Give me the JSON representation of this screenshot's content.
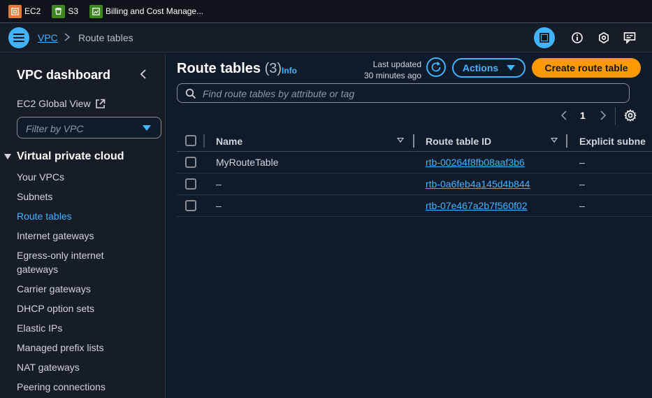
{
  "favorites": [
    {
      "label": "EC2",
      "icon": "ec2-icon",
      "color": "#e07b39"
    },
    {
      "label": "S3",
      "icon": "s3-icon",
      "color": "#3f8624"
    },
    {
      "label": "Billing and Cost Manage...",
      "icon": "billing-icon",
      "color": "#3f8624"
    }
  ],
  "topnav": {
    "service": "VPC",
    "current": "Route tables"
  },
  "sidebar": {
    "title": "VPC dashboard",
    "ec2_global_view": "EC2 Global View",
    "filter_placeholder": "Filter by VPC",
    "section": "Virtual private cloud",
    "items": [
      {
        "label": "Your VPCs"
      },
      {
        "label": "Subnets"
      },
      {
        "label": "Route tables"
      },
      {
        "label": "Internet gateways"
      },
      {
        "label": "Egress-only internet gateways"
      },
      {
        "label": "Carrier gateways"
      },
      {
        "label": "DHCP option sets"
      },
      {
        "label": "Elastic IPs"
      },
      {
        "label": "Managed prefix lists"
      },
      {
        "label": "NAT gateways"
      },
      {
        "label": "Peering connections"
      }
    ]
  },
  "main": {
    "title": "Route tables",
    "count": "(3)",
    "info": "Info",
    "last_updated_line1": "Last updated",
    "last_updated_line2": "30 minutes ago",
    "actions_label": "Actions",
    "create_label": "Create route table",
    "search_placeholder": "Find route tables by attribute or tag",
    "page": "1",
    "columns": [
      "Name",
      "Route table ID",
      "Explicit subne"
    ],
    "rows": [
      {
        "name": "MyRouteTable",
        "id": "rtb-00264f8fb08aaf3b6",
        "explicit": "–"
      },
      {
        "name": "–",
        "id": "rtb-0a6feb4a145d4b844",
        "explicit": "–"
      },
      {
        "name": "–",
        "id": "rtb-07e467a2b7f560f02",
        "explicit": "–"
      }
    ]
  },
  "colors": {
    "accent": "#42b4ff",
    "primary_button": "#ff9900",
    "background": "#0f1b2a"
  }
}
